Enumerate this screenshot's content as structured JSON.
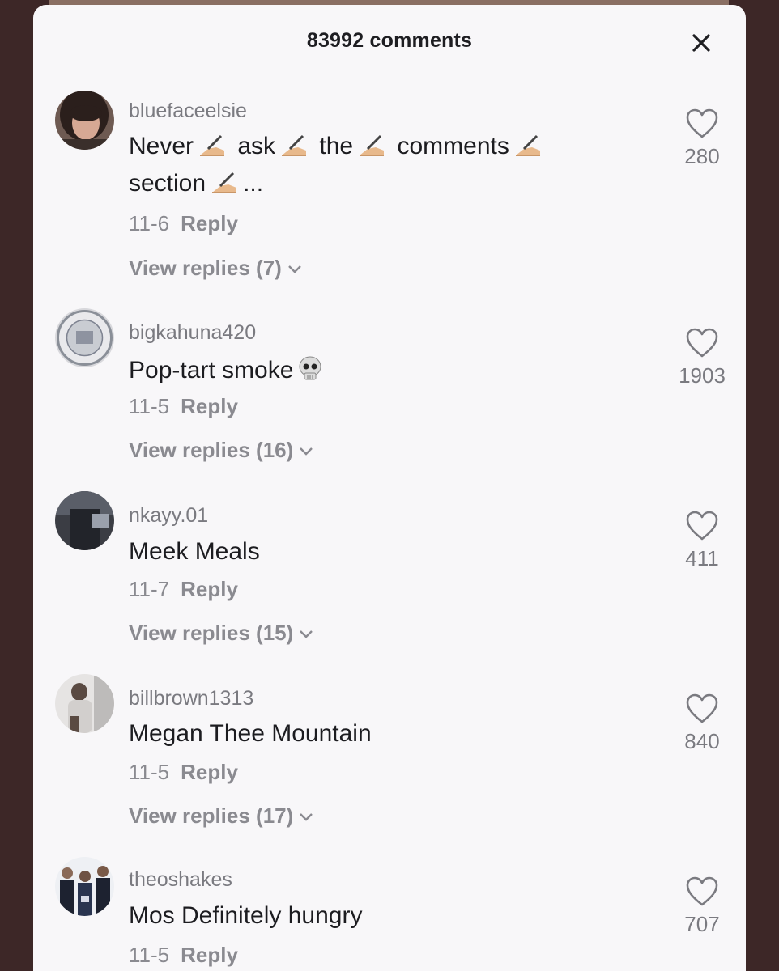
{
  "header": {
    "title": "83992 comments"
  },
  "comments": [
    {
      "username": "bluefaceelsie",
      "words": [
        "Never",
        "ask",
        "the",
        "comments",
        "section"
      ],
      "ellipsis": "...",
      "date": "11-6",
      "reply_label": "Reply",
      "view_replies": "View replies (7)",
      "likes": "280"
    },
    {
      "username": "bigkahuna420",
      "text": "Pop-tart smoke",
      "date": "11-5",
      "reply_label": "Reply",
      "view_replies": "View replies (16)",
      "likes": "1903"
    },
    {
      "username": "nkayy.01",
      "text": "Meek Meals",
      "date": "11-7",
      "reply_label": "Reply",
      "view_replies": "View replies (15)",
      "likes": "411"
    },
    {
      "username": "billbrown1313",
      "text": "Megan Thee Mountain",
      "date": "11-5",
      "reply_label": "Reply",
      "view_replies": "View replies (17)",
      "likes": "840"
    },
    {
      "username": "theoshakes",
      "text": "Mos Definitely hungry",
      "date": "11-5",
      "reply_label": "Reply",
      "likes": "707"
    }
  ],
  "icons": {
    "close": "close-icon",
    "like": "heart-icon",
    "expand": "chevron-down-icon",
    "writing_hand": "writing-hand-emoji",
    "skull": "skull-emoji"
  }
}
